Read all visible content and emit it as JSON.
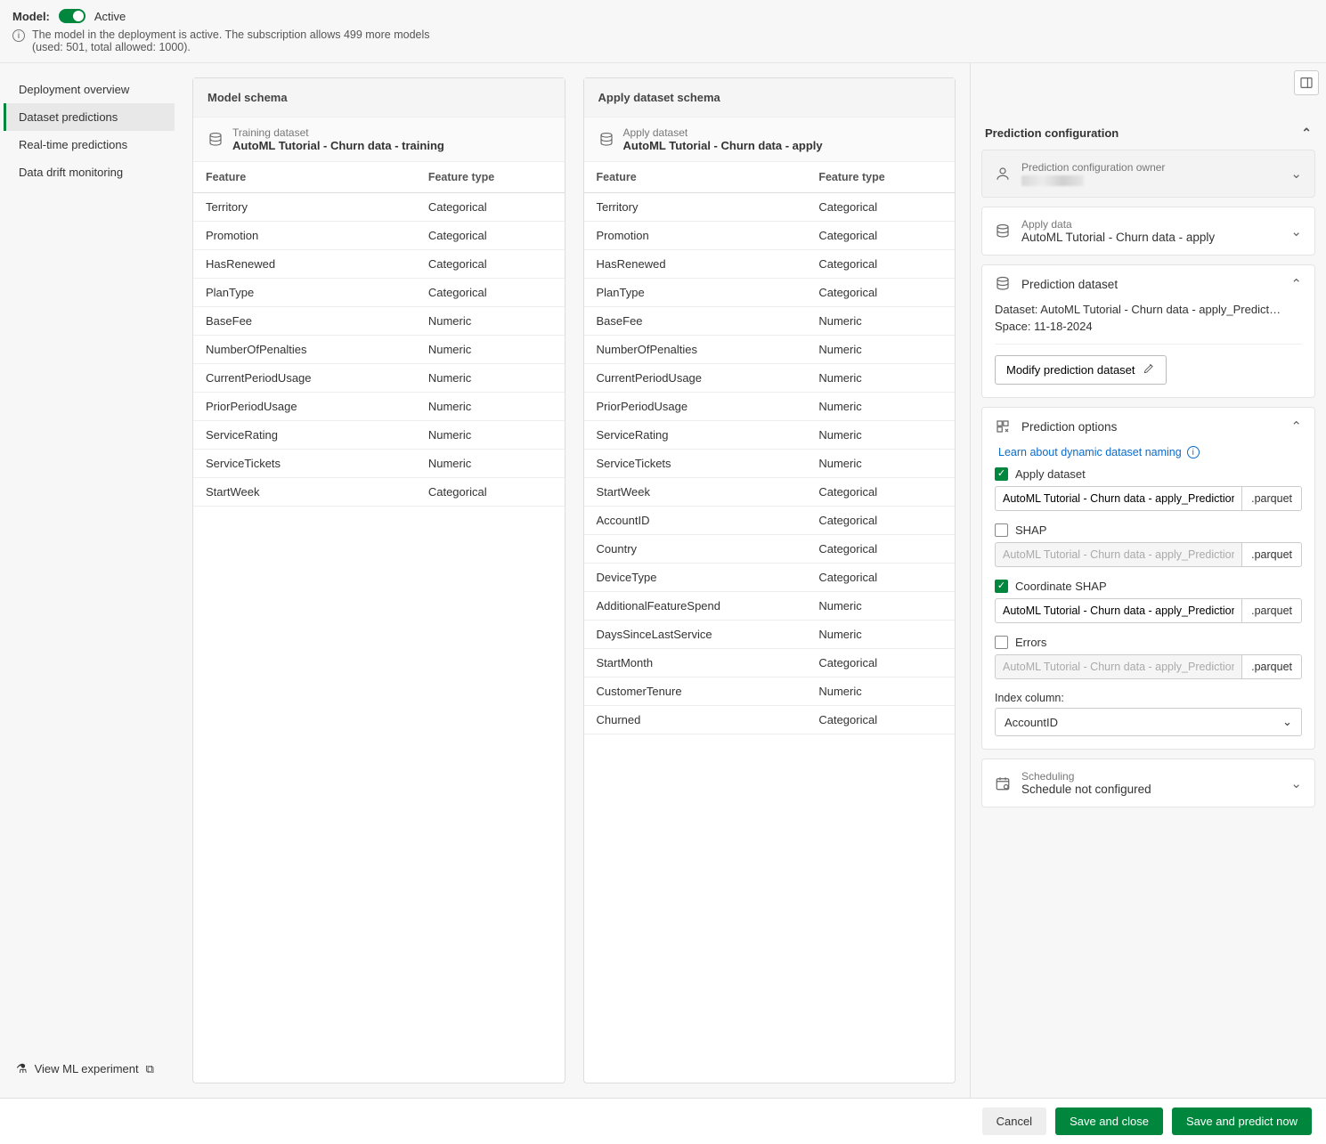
{
  "topbar": {
    "model_label": "Model:",
    "status_text": "Active",
    "info_text": "The model in the deployment is active. The subscription allows 499 more models (used: 501, total allowed: 1000)."
  },
  "nav": {
    "items": [
      {
        "label": "Deployment overview",
        "active": false
      },
      {
        "label": "Dataset predictions",
        "active": true
      },
      {
        "label": "Real-time predictions",
        "active": false
      },
      {
        "label": "Data drift monitoring",
        "active": false
      }
    ],
    "footer_label": "View ML experiment"
  },
  "model_schema": {
    "title": "Model schema",
    "dataset_label": "Training dataset",
    "dataset_name": "AutoML Tutorial - Churn data - training",
    "headers": {
      "feature": "Feature",
      "type": "Feature type"
    },
    "rows": [
      {
        "feature": "Territory",
        "type": "Categorical"
      },
      {
        "feature": "Promotion",
        "type": "Categorical"
      },
      {
        "feature": "HasRenewed",
        "type": "Categorical"
      },
      {
        "feature": "PlanType",
        "type": "Categorical"
      },
      {
        "feature": "BaseFee",
        "type": "Numeric"
      },
      {
        "feature": "NumberOfPenalties",
        "type": "Numeric"
      },
      {
        "feature": "CurrentPeriodUsage",
        "type": "Numeric"
      },
      {
        "feature": "PriorPeriodUsage",
        "type": "Numeric"
      },
      {
        "feature": "ServiceRating",
        "type": "Numeric"
      },
      {
        "feature": "ServiceTickets",
        "type": "Numeric"
      },
      {
        "feature": "StartWeek",
        "type": "Categorical"
      }
    ]
  },
  "apply_schema": {
    "title": "Apply dataset schema",
    "dataset_label": "Apply dataset",
    "dataset_name": "AutoML Tutorial - Churn data - apply",
    "headers": {
      "feature": "Feature",
      "type": "Feature type"
    },
    "rows": [
      {
        "feature": "Territory",
        "type": "Categorical"
      },
      {
        "feature": "Promotion",
        "type": "Categorical"
      },
      {
        "feature": "HasRenewed",
        "type": "Categorical"
      },
      {
        "feature": "PlanType",
        "type": "Categorical"
      },
      {
        "feature": "BaseFee",
        "type": "Numeric"
      },
      {
        "feature": "NumberOfPenalties",
        "type": "Numeric"
      },
      {
        "feature": "CurrentPeriodUsage",
        "type": "Numeric"
      },
      {
        "feature": "PriorPeriodUsage",
        "type": "Numeric"
      },
      {
        "feature": "ServiceRating",
        "type": "Numeric"
      },
      {
        "feature": "ServiceTickets",
        "type": "Numeric"
      },
      {
        "feature": "StartWeek",
        "type": "Categorical"
      },
      {
        "feature": "AccountID",
        "type": "Categorical"
      },
      {
        "feature": "Country",
        "type": "Categorical"
      },
      {
        "feature": "DeviceType",
        "type": "Categorical"
      },
      {
        "feature": "AdditionalFeatureSpend",
        "type": "Numeric"
      },
      {
        "feature": "DaysSinceLastService",
        "type": "Numeric"
      },
      {
        "feature": "StartMonth",
        "type": "Categorical"
      },
      {
        "feature": "CustomerTenure",
        "type": "Numeric"
      },
      {
        "feature": "Churned",
        "type": "Categorical"
      }
    ]
  },
  "config": {
    "title": "Prediction configuration",
    "owner_section": {
      "label": "Prediction configuration owner"
    },
    "apply_data_section": {
      "label": "Apply data",
      "value": "AutoML Tutorial - Churn data - apply"
    },
    "prediction_dataset_section": {
      "label": "Prediction dataset",
      "dataset_line": "Dataset: AutoML Tutorial - Churn data - apply_Predict…",
      "space_line": "Space: 11-18-2024",
      "modify_btn": "Modify prediction dataset"
    },
    "options_section": {
      "label": "Prediction options",
      "learn_link": "Learn about dynamic dataset naming",
      "file_ext": ".parquet",
      "apply_dataset": {
        "label": "Apply dataset",
        "checked": true,
        "value": "AutoML Tutorial - Churn data - apply_Prediction"
      },
      "shap": {
        "label": "SHAP",
        "checked": false,
        "value": "AutoML Tutorial - Churn data - apply_Prediction"
      },
      "coord_shap": {
        "label": "Coordinate SHAP",
        "checked": true,
        "value": "AutoML Tutorial - Churn data - apply_Prediction"
      },
      "errors": {
        "label": "Errors",
        "checked": false,
        "value": "AutoML Tutorial - Churn data - apply_Prediction"
      },
      "index_label": "Index column:",
      "index_value": "AccountID"
    },
    "scheduling_section": {
      "label": "Scheduling",
      "value": "Schedule not configured"
    }
  },
  "footer": {
    "cancel": "Cancel",
    "save": "Save and close",
    "predict": "Save and predict now"
  }
}
